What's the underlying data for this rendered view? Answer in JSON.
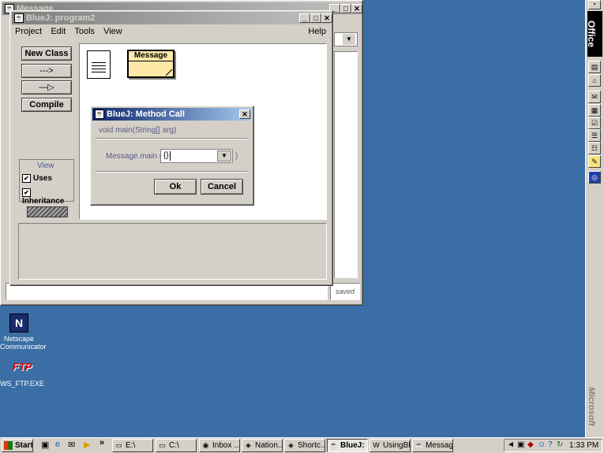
{
  "back_window": {
    "title": "Message",
    "status_text": "saved"
  },
  "bluej_window": {
    "title": "BlueJ:  program2",
    "menu": [
      "Project",
      "Edit",
      "Tools",
      "View"
    ],
    "help": "Help",
    "new_class": "New Class",
    "uses_arrow": "--->",
    "inherit_arrow": "—▷",
    "compile": "Compile",
    "view_group": "View",
    "uses": "Uses",
    "inheritance": "Inheritance",
    "class_name": "Message"
  },
  "dialog": {
    "title": "BlueJ:  Method Call",
    "signature": "void main(String[] arg)",
    "call_label": "Message.main (",
    "arg_value": "{}",
    "close_paren": ")",
    "ok": "Ok",
    "cancel": "Cancel"
  },
  "desktop": {
    "netscape_l1": "Netscape",
    "netscape_l2": "Communicator",
    "ftp_label": "WS_FTP.EXE"
  },
  "office_bar": {
    "title": "Office",
    "brand": "Microsoft"
  },
  "taskbar": {
    "start": "Start",
    "chevron": "»",
    "tasks": [
      "E:\\",
      "C:\\",
      "Inbox ...",
      "Nation...",
      "Shortc...",
      "BlueJ: ...",
      "UsingBl...",
      "Message"
    ],
    "clock": "1:33 PM"
  }
}
